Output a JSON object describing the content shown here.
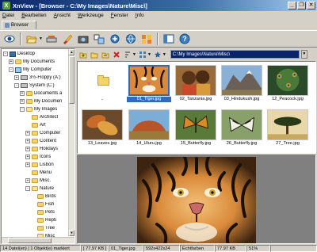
{
  "window": {
    "title": "XnView - [Browser - C:\\My Images\\Nature\\Misc\\]",
    "app_icon_letter": "X",
    "controls": {
      "minimize": "_",
      "restore": "❐",
      "close": "✕"
    }
  },
  "menu": [
    "Datei",
    "Bearbeiten",
    "Ansicht",
    "Werkzeuge",
    "Fenster",
    "Info"
  ],
  "tab": {
    "label": "Browser"
  },
  "toolbar_icons": [
    "eye-icon",
    "open-folder-icon",
    "scanner-icon",
    "brush-icon",
    "camera-icon",
    "convert-icon",
    "gear-icon",
    "web-icon",
    "mosaic-icon",
    "panel-icon",
    "help-icon"
  ],
  "tree": {
    "items": [
      {
        "label": "Desktop",
        "level": 0,
        "expander": "-",
        "icon": "desktop"
      },
      {
        "label": "My Documents",
        "level": 1,
        "expander": "+",
        "icon": "folder"
      },
      {
        "label": "My Computer",
        "level": 1,
        "expander": "-",
        "icon": "computer"
      },
      {
        "label": "3½-Floppy (A:)",
        "level": 2,
        "expander": "+",
        "icon": "drive"
      },
      {
        "label": "System (C:)",
        "level": 2,
        "expander": "-",
        "icon": "drive"
      },
      {
        "label": "Documents a",
        "level": 3,
        "expander": "+",
        "icon": "folder"
      },
      {
        "label": "My Documen",
        "level": 3,
        "expander": "+",
        "icon": "folder"
      },
      {
        "label": "My Images",
        "level": 3,
        "expander": "-",
        "icon": "folder-open"
      },
      {
        "label": "Architect",
        "level": 4,
        "expander": "",
        "icon": "folder"
      },
      {
        "label": "Art",
        "level": 4,
        "expander": "",
        "icon": "folder"
      },
      {
        "label": "Computer",
        "level": 4,
        "expander": "+",
        "icon": "folder"
      },
      {
        "label": "Content",
        "level": 4,
        "expander": "+",
        "icon": "folder"
      },
      {
        "label": "Holidays",
        "level": 4,
        "expander": "+",
        "icon": "folder"
      },
      {
        "label": "Icons",
        "level": 4,
        "expander": "+",
        "icon": "folder"
      },
      {
        "label": "Lisbon",
        "level": 4,
        "expander": "+",
        "icon": "folder"
      },
      {
        "label": "Menu",
        "level": 4,
        "expander": "",
        "icon": "folder"
      },
      {
        "label": "Misc.",
        "level": 4,
        "expander": "+",
        "icon": "folder"
      },
      {
        "label": "Nature",
        "level": 4,
        "expander": "-",
        "icon": "folder-open"
      },
      {
        "label": "Birds",
        "level": 5,
        "expander": "",
        "icon": "folder"
      },
      {
        "label": "Fish",
        "level": 5,
        "expander": "",
        "icon": "folder"
      },
      {
        "label": "Pets",
        "level": 5,
        "expander": "",
        "icon": "folder"
      },
      {
        "label": "Repti",
        "level": 5,
        "expander": "",
        "icon": "folder"
      },
      {
        "label": "Tree",
        "level": 5,
        "expander": "",
        "icon": "folder"
      },
      {
        "label": "Misc",
        "level": 5,
        "expander": "",
        "icon": "folder-open"
      }
    ]
  },
  "browser_toolbar": {
    "icons": [
      "up-folder-icon",
      "new-folder-icon",
      "copy-to-icon",
      "delete-icon",
      "sort-icon",
      "view-mode-icon",
      "favorite-icon"
    ],
    "path": "C:\\My Images\\Nature\\Misc\\"
  },
  "thumbnails": [
    {
      "label": "..",
      "kind": "parent",
      "selected": false
    },
    {
      "label": "01_Tiger.jpg",
      "kind": "tiger",
      "selected": true
    },
    {
      "label": "02_Tanzania.jpg",
      "kind": "children",
      "selected": false
    },
    {
      "label": "03_Hindukush.jpg",
      "kind": "mountain",
      "selected": false
    },
    {
      "label": "12_Peacock.jpg",
      "kind": "peacock",
      "selected": false
    },
    {
      "label": "13_Leaves.jpg",
      "kind": "leaves",
      "selected": false
    },
    {
      "label": "14_Uluru.jpg",
      "kind": "uluru",
      "selected": false
    },
    {
      "label": "15_Butterfly.jpg",
      "kind": "butterfly1",
      "selected": false
    },
    {
      "label": "26_Butterfly.jpg",
      "kind": "butterfly2",
      "selected": false
    },
    {
      "label": "27_Tree.jpg",
      "kind": "tree",
      "selected": false
    }
  ],
  "status": {
    "objects": "14 Datei(en) | 1 Objekt(e) markiert",
    "size": "[ 77.97 KB ]",
    "file": "01_Tiger.jpg",
    "dims": "592x422x24",
    "color": "Echtfarben",
    "size2": "77.97 KB",
    "zoom": "51%"
  }
}
